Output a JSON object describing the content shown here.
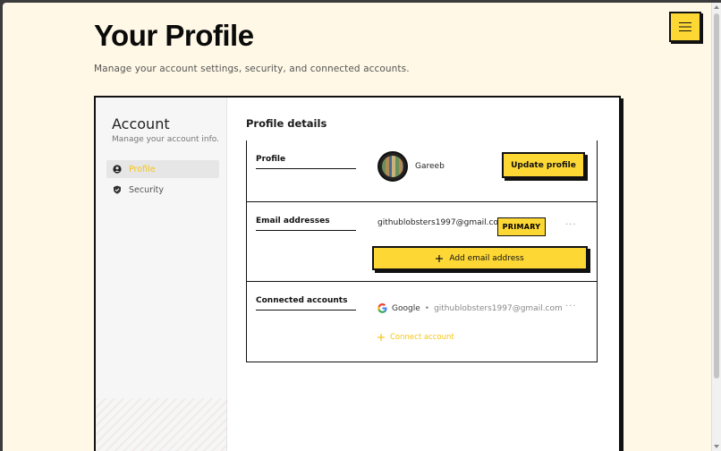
{
  "header": {
    "title": "Your Profile",
    "subtitle": "Manage your account settings, security, and connected accounts.",
    "menu_icon": "hamburger-menu-icon"
  },
  "sidebar": {
    "title": "Account",
    "subtitle": "Manage your account info.",
    "items": [
      {
        "label": "Profile",
        "icon": "user-circle-icon",
        "active": true
      },
      {
        "label": "Security",
        "icon": "shield-check-icon",
        "active": false
      }
    ]
  },
  "main": {
    "title": "Profile details",
    "profile": {
      "label": "Profile",
      "username": "Gareeb",
      "update_button": "Update profile"
    },
    "email": {
      "label": "Email addresses",
      "address": "githublobsters1997@gmail.com",
      "badge": "PRIMARY",
      "more": "···",
      "add_button": "Add email address"
    },
    "connected": {
      "label": "Connected accounts",
      "provider": "Google",
      "separator": "•",
      "account": "githublobsters1997@gmail.com",
      "more": "···",
      "connect_link": "Connect account"
    }
  },
  "colors": {
    "background": "#fff8e6",
    "accent": "#fdd835",
    "accent_text": "#f5c518",
    "border": "#111111"
  }
}
